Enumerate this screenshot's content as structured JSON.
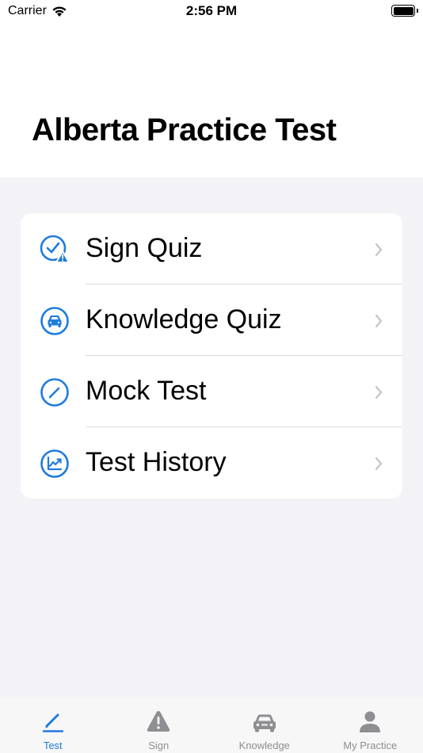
{
  "status_bar": {
    "carrier": "Carrier",
    "time": "2:56 PM"
  },
  "header": {
    "title": "Alberta Practice Test"
  },
  "menu": {
    "items": [
      {
        "label": "Sign Quiz",
        "icon": "check-warning-icon"
      },
      {
        "label": "Knowledge Quiz",
        "icon": "car-icon"
      },
      {
        "label": "Mock Test",
        "icon": "pencil-icon"
      },
      {
        "label": "Test History",
        "icon": "chart-icon"
      }
    ]
  },
  "tab_bar": {
    "tabs": [
      {
        "label": "Test",
        "icon": "pencil-icon",
        "active": true
      },
      {
        "label": "Sign",
        "icon": "warning-icon",
        "active": false
      },
      {
        "label": "Knowledge",
        "icon": "car-icon",
        "active": false
      },
      {
        "label": "My Practice",
        "icon": "person-icon",
        "active": false
      }
    ]
  },
  "colors": {
    "accent": "#1e7be0",
    "background": "#f2f2f7",
    "card": "#ffffff",
    "inactive": "#8e8e93"
  }
}
